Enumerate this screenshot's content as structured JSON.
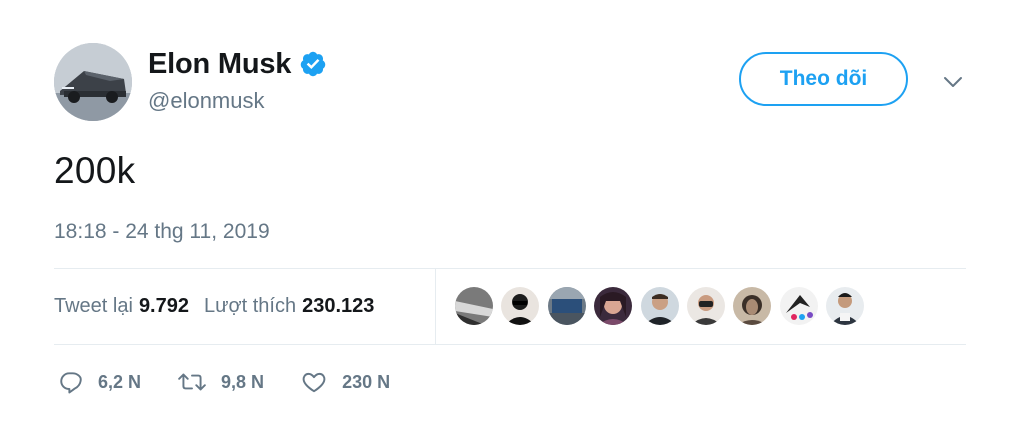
{
  "author": {
    "display_name": "Elon Musk",
    "handle": "@elonmusk",
    "verified": true
  },
  "follow_button": {
    "label": "Theo dõi"
  },
  "tweet": {
    "text": "200k",
    "timestamp": "18:18 - 24 thg 11, 2019"
  },
  "stats": {
    "retweets_label": "Tweet lại",
    "retweets_value": "9.792",
    "likes_label": "Lượt thích",
    "likes_value": "230.123"
  },
  "actions": {
    "reply_count": "6,2 N",
    "retweet_count": "9,8 N",
    "like_count": "230 N"
  },
  "colors": {
    "accent": "#1da1f2",
    "secondary_text": "#657786",
    "primary_text": "#14171a",
    "divider": "#e6ecf0"
  },
  "icons": {
    "verified": "verified-badge-icon",
    "caret": "chevron-down-icon",
    "reply": "reply-icon",
    "retweet": "retweet-icon",
    "like": "heart-icon"
  }
}
